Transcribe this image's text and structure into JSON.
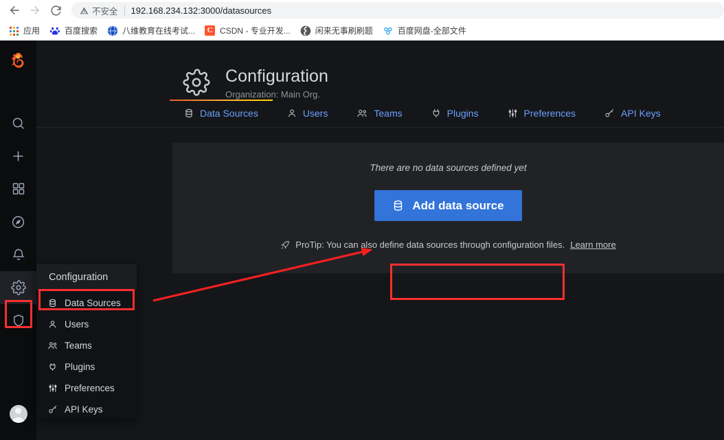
{
  "browser": {
    "nav": {
      "back_icon": "arrow-left-icon",
      "forward_icon": "arrow-right-icon",
      "reload_icon": "reload-icon"
    },
    "omnibox": {
      "security_icon": "warning-triangle-icon",
      "security_label": "不安全",
      "url": "192.168.234.132:3000/datasources"
    },
    "bookmarks": [
      {
        "label": "应用",
        "icon": "apps-grid-icon",
        "color": "#4285f4"
      },
      {
        "label": "百度搜索",
        "icon": "baidu-paw-icon",
        "color": "#2932e1"
      },
      {
        "label": "八维教育在线考试...",
        "icon": "globe-blue-icon",
        "color": "#1a4fbf"
      },
      {
        "label": "CSDN - 专业开发...",
        "icon": "csdn-icon",
        "color": "#fc5531",
        "glyph": "C"
      },
      {
        "label": "闲来无事刷刷题",
        "icon": "globe-dark-icon",
        "color": "#3c4043"
      },
      {
        "label": "百度网盘-全部文件",
        "icon": "baidu-pan-icon",
        "color": "#3ba7f5"
      }
    ]
  },
  "app": {
    "rail": {
      "logo_icon": "grafana-logo-icon",
      "items": [
        {
          "name": "search",
          "icon": "search-icon"
        },
        {
          "name": "create",
          "icon": "plus-icon"
        },
        {
          "name": "dashboards",
          "icon": "apps-grid-icon"
        },
        {
          "name": "explore",
          "icon": "compass-icon"
        },
        {
          "name": "alerting",
          "icon": "bell-icon"
        },
        {
          "name": "configuration",
          "icon": "gear-icon",
          "active": true
        },
        {
          "name": "server-admin",
          "icon": "shield-icon"
        }
      ],
      "avatar_icon": "user-avatar-icon"
    },
    "flyout": {
      "header": "Configuration",
      "items": [
        {
          "label": "Data Sources",
          "icon": "database-icon",
          "highlighted": true
        },
        {
          "label": "Users",
          "icon": "user-icon"
        },
        {
          "label": "Teams",
          "icon": "users-icon"
        },
        {
          "label": "Plugins",
          "icon": "plug-icon"
        },
        {
          "label": "Preferences",
          "icon": "sliders-icon"
        },
        {
          "label": "API Keys",
          "icon": "key-icon"
        }
      ]
    },
    "header": {
      "icon": "gear-icon",
      "title": "Configuration",
      "subtitle": "Organization: Main Org."
    },
    "tabs": [
      {
        "label": "Data Sources",
        "icon": "database-icon",
        "active": true
      },
      {
        "label": "Users",
        "icon": "user-icon",
        "active": false
      },
      {
        "label": "Teams",
        "icon": "users-icon",
        "active": false
      },
      {
        "label": "Plugins",
        "icon": "plug-icon",
        "active": false
      },
      {
        "label": "Preferences",
        "icon": "sliders-icon",
        "active": false
      },
      {
        "label": "API Keys",
        "icon": "key-icon",
        "active": false
      }
    ],
    "content": {
      "empty_message": "There are no data sources defined yet",
      "add_button_label": "Add data source",
      "add_button_icon": "database-icon",
      "add_button_color": "#3274d9",
      "protip_icon": "rocket-icon",
      "protip_text": "ProTip: You can also define data sources through configuration files.",
      "protip_link": "Learn more"
    },
    "annotations": {
      "highlight_color": "#fc2f2f",
      "arrow_color": "#f32020"
    }
  }
}
